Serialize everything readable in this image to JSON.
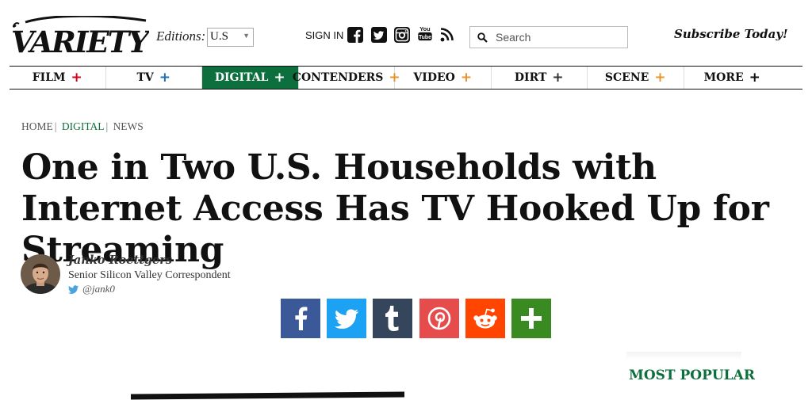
{
  "header": {
    "logo_text": "VARIETY",
    "editions_label": "Editions:",
    "edition_value": "U.S",
    "signin_label": "SIGN IN",
    "social_icons": [
      "facebook-icon",
      "twitter-icon",
      "instagram-icon",
      "youtube-icon",
      "rss-icon"
    ],
    "youtube_top": "You",
    "youtube_bottom": "Tube",
    "search_placeholder": "Search",
    "subscribe_label": "Subscribe Today!"
  },
  "nav": {
    "items": [
      {
        "label": "FILM",
        "plus_color": "#d0021b"
      },
      {
        "label": "TV",
        "plus_color": "#1f6fb6"
      },
      {
        "label": "DIGITAL",
        "plus_color": "#ffffff",
        "active": true
      },
      {
        "label": "CONTENDERS",
        "plus_color": "#e8932b"
      },
      {
        "label": "VIDEO",
        "plus_color": "#e8932b"
      },
      {
        "label": "DIRT",
        "plus_color": "#333333"
      },
      {
        "label": "SCENE",
        "plus_color": "#e8932b"
      },
      {
        "label": "MORE",
        "plus_color": "#111111"
      }
    ],
    "plus_glyph": "+"
  },
  "article": {
    "breadcrumb": [
      "HOME",
      "DIGITAL",
      "NEWS"
    ],
    "breadcrumb_sep": "|",
    "title": "One in Two U.S. Households with Internet Access Has TV Hooked Up for Streaming",
    "author": {
      "name": "Janko Roettgers",
      "title": "Senior Silicon Valley Correspondent",
      "twitter": "@jank0"
    }
  },
  "share_buttons": [
    {
      "name": "facebook",
      "color": "#3b5998"
    },
    {
      "name": "twitter",
      "color": "#1da1f2"
    },
    {
      "name": "tumblr",
      "color": "#35465c"
    },
    {
      "name": "pinterest",
      "color": "#e74c4c"
    },
    {
      "name": "reddit",
      "color": "#ff4500"
    },
    {
      "name": "more",
      "color": "#3a8a22"
    }
  ],
  "sidebar": {
    "most_popular_label": "MOST POPULAR"
  },
  "colors": {
    "brand_green": "#0d6f3d"
  }
}
